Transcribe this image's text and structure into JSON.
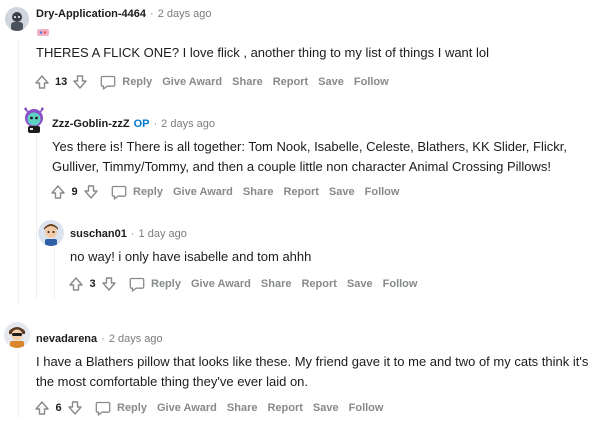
{
  "comments": [
    {
      "username": "Dry-Application-4464",
      "time": "2 days ago",
      "text_lines": [
        "THERES A FLICK ONE? I love flick , another thing to my list of things I want lol"
      ],
      "score": "13",
      "is_op": false
    },
    {
      "username": "Zzz-Goblin-zzZ",
      "op_label": "OP",
      "time": "2 days ago",
      "text_lines": [
        "Yes there is! There is all together: Tom Nook, Isabelle, Celeste, Blathers, KK Slider, Flickr,",
        "Gulliver, Timmy/Tommy, and then a couple little non character Animal Crossing Pillows!"
      ],
      "score": "9",
      "is_op": true
    },
    {
      "username": "suschan01",
      "time": "1 day ago",
      "text_lines": [
        "no way! i only have isabelle and tom ahhh"
      ],
      "score": "3",
      "is_op": false
    },
    {
      "username": "nevadarena",
      "time": "2 days ago",
      "text_lines": [
        "I have a Blathers pillow that looks like these. My friend gave it to me and two of my cats think it's",
        "the most comfortable thing they've ever laid on."
      ],
      "score": "6",
      "is_op": false
    }
  ],
  "actions": {
    "reply": "Reply",
    "give_award": "Give Award",
    "share": "Share",
    "report": "Report",
    "save": "Save",
    "follow": "Follow"
  },
  "separator": "·",
  "icons": {
    "upvote": "upvote-arrow-icon",
    "downvote": "downvote-arrow-icon",
    "reply": "speech-bubble-icon"
  },
  "colors": {
    "op": "#0079d3",
    "meta": "#7c7c7c",
    "action": "#878a8c",
    "thread_line": "#edeff1"
  }
}
